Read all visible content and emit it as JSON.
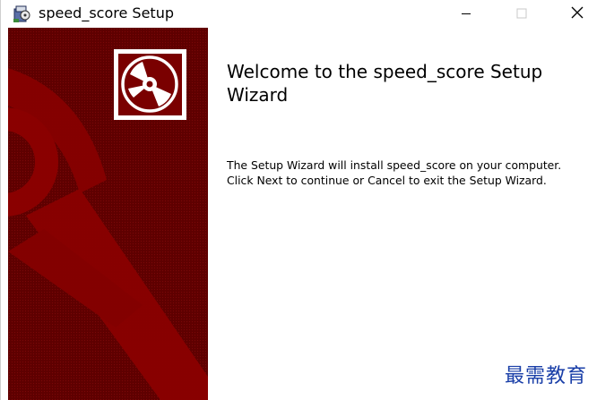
{
  "window": {
    "title": "speed_score Setup",
    "controls": {
      "minimize": "minimize-icon",
      "maximize": "maximize-icon",
      "close": "close-icon"
    }
  },
  "side_panel": {
    "background_color": "#6b0000",
    "logo_icon": "disc-icon"
  },
  "content": {
    "heading": "Welcome to the speed_score Setup Wizard",
    "body_line1": "The Setup Wizard will install speed_score on your computer.",
    "body_line2": "Click Next to continue or Cancel to exit the Setup Wizard."
  },
  "watermark": {
    "text": "最需教育",
    "color": "#1a3fa8"
  }
}
